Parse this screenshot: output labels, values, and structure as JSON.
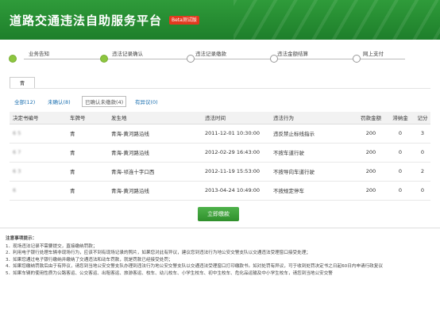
{
  "header": {
    "title": "道路交通违法自助服务平台",
    "beta": "Beta测试版"
  },
  "steps": [
    "业务告知",
    "违法记录确认",
    "违法记录缴款",
    "违法金额结算",
    "网上支付"
  ],
  "plate_tab": "青",
  "filters": [
    {
      "label": "全部(12)",
      "active": false
    },
    {
      "label": "未确认(8)",
      "active": false
    },
    {
      "label": "已确认未缴款(4)",
      "active": true
    },
    {
      "label": "有异议(0)",
      "active": false
    }
  ],
  "table": {
    "headers": [
      "决定书编号",
      "车牌号",
      "发生地",
      "违法时间",
      "违法行为",
      "罚款金额",
      "滞纳金",
      "记分"
    ],
    "rows": [
      {
        "id": "6     5",
        "plate": "青",
        "place": "青海-黄河路沿线",
        "time": "2011-12-01 10:30:00",
        "action": "违反禁止标线指示",
        "fine": "200",
        "late": "0",
        "pts": "3"
      },
      {
        "id": "6     7",
        "plate": "青",
        "place": "青海-黄河路沿线",
        "time": "2012-02-29 16:43:00",
        "action": "不按车道行驶",
        "fine": "200",
        "late": "0",
        "pts": "0"
      },
      {
        "id": "6     3",
        "plate": "青",
        "place": "青海-祁连十字口西",
        "time": "2012-11-19 15:53:00",
        "action": "不按导向车道行驶",
        "fine": "200",
        "late": "0",
        "pts": "2"
      },
      {
        "id": "      6",
        "plate": "青",
        "place": "青海-黄河路沿线",
        "time": "2013-04-24 10:49:00",
        "action": "不按规定停车",
        "fine": "200",
        "late": "0",
        "pts": "0"
      }
    ]
  },
  "pay_button": "立即缴款",
  "notes": {
    "title": "注意事项提示：",
    "items": [
      "1．现场违法记录不需要提交，直接缴纳罚款；",
      "2．利用电子银行处理车辆非现场行为，应该不到有现场记录的照片，如果您对此有异议，建议您到违法行为地公安交警支队以交通违法受理窗口接受处理；",
      "3．如果您通过电子银行缴纳并缴纳了交通违法和动车罚款，就是罚款已经接受处罚；",
      "4．如果您缴纳罚款后由于有异议，请您到当地公安交警支队办理到违法行为地公安交警支队以交通违法受理窗口打印缴款书。如对处罚有异议，可于收到处罚决定书之日起60日内申请行政复议",
      "5．如果车辆的使用性质为公路客运、公交客运、出租客运、旅游客运、校车、幼儿校车、小学生校车、初中生校车、危化品运输及中小学生校车，请您到当地公安交警"
    ]
  },
  "colors": {
    "header": "#2f9b3a",
    "beta": "#e23a1f",
    "link": "#1a6fb0",
    "pay": "#2f8f2c",
    "step_done": "#8dc63f"
  }
}
